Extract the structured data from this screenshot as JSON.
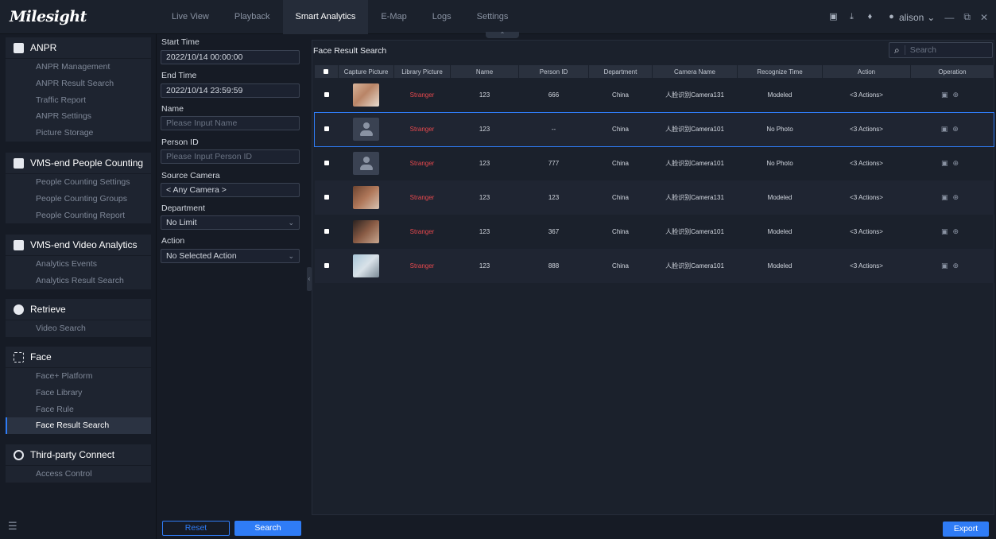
{
  "app": {
    "logo": "Milesight"
  },
  "nav": [
    {
      "label": "Live View"
    },
    {
      "label": "Playback"
    },
    {
      "label": "Smart Analytics"
    },
    {
      "label": "E-Map"
    },
    {
      "label": "Logs"
    },
    {
      "label": "Settings"
    }
  ],
  "user": {
    "name": "alison"
  },
  "sidebar": {
    "anpr": {
      "title": "ANPR",
      "items": [
        "ANPR Management",
        "ANPR Result Search",
        "Traffic Report",
        "ANPR Settings",
        "Picture Storage"
      ]
    },
    "people": {
      "title": "VMS-end People Counting",
      "items": [
        "People Counting Settings",
        "People Counting Groups",
        "People Counting Report"
      ]
    },
    "video": {
      "title": "VMS-end Video Analytics",
      "items": [
        "Analytics Events",
        "Analytics Result Search"
      ]
    },
    "retrieve": {
      "title": "Retrieve",
      "items": [
        "Video Search"
      ]
    },
    "face": {
      "title": "Face",
      "items": [
        "Face+ Platform",
        "Face Library",
        "Face Rule",
        "Face Result Search"
      ]
    },
    "third": {
      "title": "Third-party Connect",
      "items": [
        "Access Control"
      ]
    }
  },
  "filter": {
    "start_label": "Start Time",
    "start_value": "2022/10/14 00:00:00",
    "end_label": "End Time",
    "end_value": "2022/10/14 23:59:59",
    "name_label": "Name",
    "name_placeholder": "Please Input Name",
    "pid_label": "Person ID",
    "pid_placeholder": "Please Input Person ID",
    "camera_label": "Source Camera",
    "camera_value": "< Any Camera >",
    "dept_label": "Department",
    "dept_value": "No Limit",
    "action_label": "Action",
    "action_value": "No Selected Action",
    "reset": "Reset",
    "search": "Search"
  },
  "main": {
    "title": "Face Result Search",
    "search_placeholder": "Search",
    "export": "Export",
    "columns": [
      "Capture Picture",
      "Library Picture",
      "Name",
      "Person ID",
      "Department",
      "Camera Name",
      "Recognize Time",
      "Action",
      "Operation"
    ],
    "rows": [
      {
        "library": "Stranger",
        "name": "123",
        "pid": "666",
        "dept": "China",
        "camera": "人脸识别Camera131",
        "time": "Modeled",
        "action": "<3 Actions>"
      },
      {
        "library": "Stranger",
        "name": "123",
        "pid": "--",
        "dept": "China",
        "camera": "人脸识别Camera101",
        "time": "No Photo",
        "action": "<3 Actions>"
      },
      {
        "library": "Stranger",
        "name": "123",
        "pid": "777",
        "dept": "China",
        "camera": "人脸识别Camera101",
        "time": "No Photo",
        "action": "<3 Actions>"
      },
      {
        "library": "Stranger",
        "name": "123",
        "pid": "123",
        "dept": "China",
        "camera": "人脸识别Camera131",
        "time": "Modeled",
        "action": "<3 Actions>"
      },
      {
        "library": "Stranger",
        "name": "123",
        "pid": "367",
        "dept": "China",
        "camera": "人脸识别Camera101",
        "time": "Modeled",
        "action": "<3 Actions>"
      },
      {
        "library": "Stranger",
        "name": "123",
        "pid": "888",
        "dept": "China",
        "camera": "人脸识别Camera101",
        "time": "Modeled",
        "action": "<3 Actions>"
      }
    ]
  },
  "colors": {
    "accent": "#2f7cf6",
    "stranger": "#e5484d"
  }
}
